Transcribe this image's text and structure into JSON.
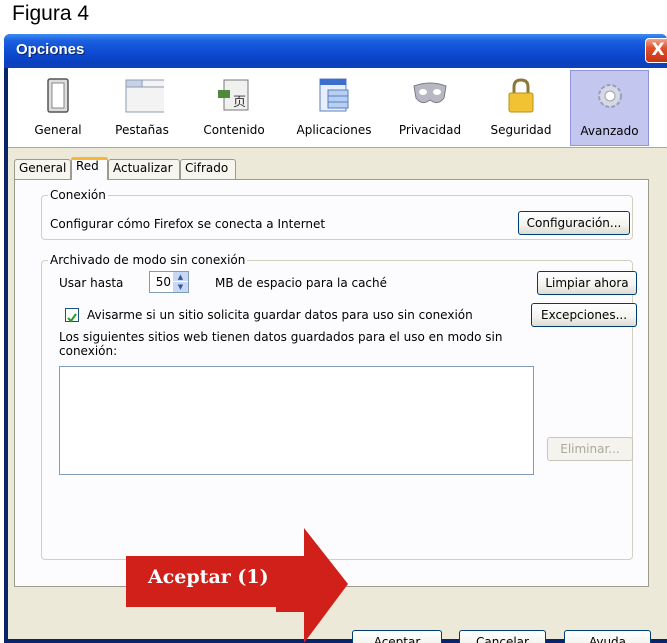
{
  "figure_label": "Figura 4",
  "window": {
    "title": "Opciones",
    "close_glyph": "X"
  },
  "toolbar": {
    "items": [
      {
        "label": "General",
        "icon": "switch-icon"
      },
      {
        "label": "Pestañas",
        "icon": "tabs-window-icon"
      },
      {
        "label": "Contenido",
        "icon": "content-icon"
      },
      {
        "label": "Aplicaciones",
        "icon": "applications-icon"
      },
      {
        "label": "Privacidad",
        "icon": "mask-icon"
      },
      {
        "label": "Seguridad",
        "icon": "padlock-icon"
      },
      {
        "label": "Avanzado",
        "icon": "gears-icon"
      }
    ],
    "selected": "Avanzado"
  },
  "tabs": [
    {
      "label": "General"
    },
    {
      "label": "Red"
    },
    {
      "label": "Actualizar"
    },
    {
      "label": "Cifrado"
    }
  ],
  "connection": {
    "legend": "Conexión",
    "description": "Configurar cómo Firefox se conecta a Internet",
    "settings_button": "Configuración..."
  },
  "offline": {
    "legend": "Archivado de modo sin conexión",
    "use_label": "Usar hasta",
    "cache_value": "50",
    "cache_unit_label": "MB de espacio para la caché",
    "clear_button": "Limpiar ahora",
    "notify_checked": true,
    "notify_label": "Avisarme si un sitio solicita guardar datos para uso sin conexión",
    "exceptions_button": "Excepciones...",
    "sites_label": "Los siguientes sitios web tienen datos guardados para el uso en modo sin conexión:",
    "remove_button": "Eliminar..."
  },
  "footer": {
    "accept_button": "Aceptar",
    "cancel_button": "Cancelar",
    "help_button": "Ayuda"
  },
  "annotation": {
    "callout_text": "Aceptar (1)",
    "color": "#d11f1a"
  },
  "colors": {
    "titlebar": "#0c4bd2",
    "dialog_bg": "#ece9d8",
    "selected_tool": "#c3c6ee"
  }
}
